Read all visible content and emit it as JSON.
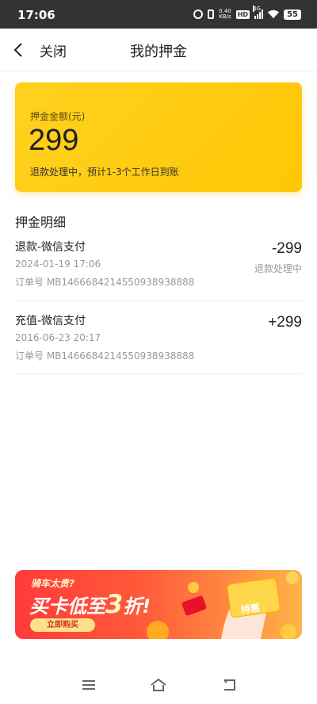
{
  "status_bar": {
    "time": "17:06",
    "net_speed_value": "0.40",
    "net_speed_unit": "KB/s",
    "hd_badge": "HD",
    "net_type": "4G",
    "battery": "55"
  },
  "nav": {
    "close_label": "关闭",
    "title": "我的押金"
  },
  "deposit": {
    "label": "押金金额(元)",
    "amount": "299",
    "note": "退款处理中，预计1-3个工作日到账"
  },
  "details": {
    "section_title": "押金明细",
    "records": [
      {
        "title": "退款-微信支付",
        "time": "2024-01-19 17:06",
        "order": "订单号 MB1466684214550938938888",
        "amount": "-299",
        "status": "退款处理中"
      },
      {
        "title": "充值-微信支付",
        "time": "2016-06-23 20:17",
        "order": "订单号 MB1466684214550938938888",
        "amount": "+299",
        "status": ""
      }
    ]
  },
  "promo": {
    "subtitle": "骑车太贵?",
    "headline": "买卡低至",
    "headline_number": "3",
    "headline_suffix": "折!",
    "button": "立即购买",
    "card_text": "特惠"
  },
  "colors": {
    "card": "#ffc705",
    "promo": "#ff3b3b",
    "status_bar": "#333333"
  }
}
